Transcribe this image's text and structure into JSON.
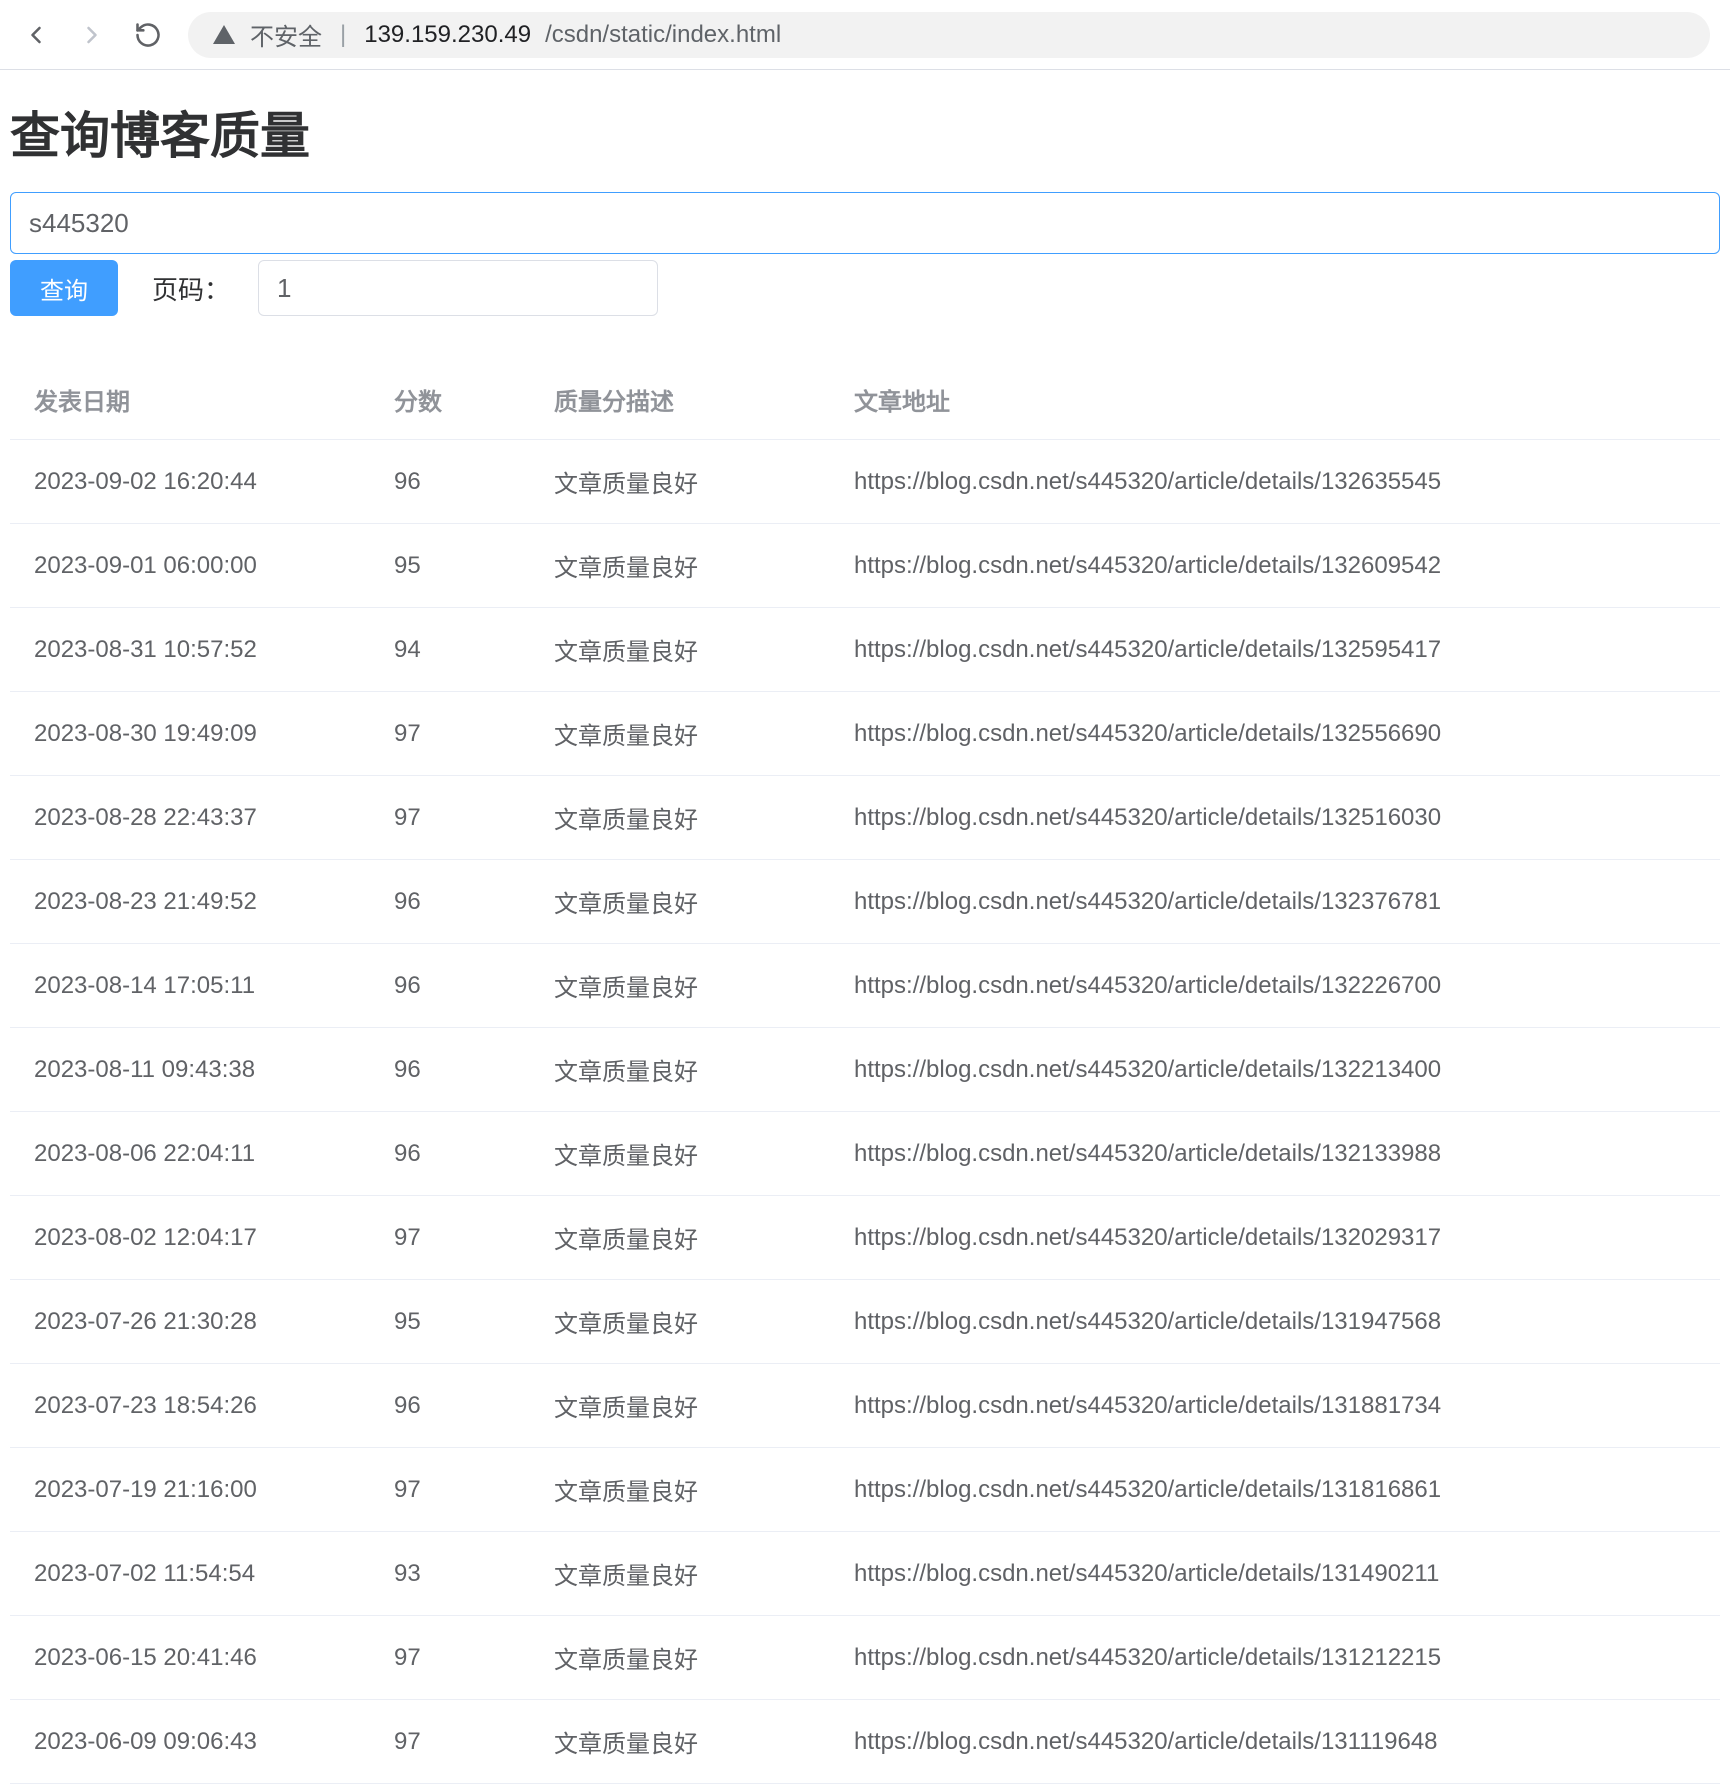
{
  "browser": {
    "insecure_label": "不安全",
    "url_host": "139.159.230.49",
    "url_path": "/csdn/static/index.html"
  },
  "page": {
    "title": "查询博客质量",
    "username_value": "s445320",
    "query_button_label": "查询",
    "page_label": "页码：",
    "page_value": "1"
  },
  "table": {
    "headers": {
      "date": "发表日期",
      "score": "分数",
      "desc": "质量分描述",
      "url": "文章地址"
    },
    "rows": [
      {
        "date": "2023-09-02 16:20:44",
        "score": "96",
        "desc": "文章质量良好",
        "url": "https://blog.csdn.net/s445320/article/details/132635545"
      },
      {
        "date": "2023-09-01 06:00:00",
        "score": "95",
        "desc": "文章质量良好",
        "url": "https://blog.csdn.net/s445320/article/details/132609542"
      },
      {
        "date": "2023-08-31 10:57:52",
        "score": "94",
        "desc": "文章质量良好",
        "url": "https://blog.csdn.net/s445320/article/details/132595417"
      },
      {
        "date": "2023-08-30 19:49:09",
        "score": "97",
        "desc": "文章质量良好",
        "url": "https://blog.csdn.net/s445320/article/details/132556690"
      },
      {
        "date": "2023-08-28 22:43:37",
        "score": "97",
        "desc": "文章质量良好",
        "url": "https://blog.csdn.net/s445320/article/details/132516030"
      },
      {
        "date": "2023-08-23 21:49:52",
        "score": "96",
        "desc": "文章质量良好",
        "url": "https://blog.csdn.net/s445320/article/details/132376781"
      },
      {
        "date": "2023-08-14 17:05:11",
        "score": "96",
        "desc": "文章质量良好",
        "url": "https://blog.csdn.net/s445320/article/details/132226700"
      },
      {
        "date": "2023-08-11 09:43:38",
        "score": "96",
        "desc": "文章质量良好",
        "url": "https://blog.csdn.net/s445320/article/details/132213400"
      },
      {
        "date": "2023-08-06 22:04:11",
        "score": "96",
        "desc": "文章质量良好",
        "url": "https://blog.csdn.net/s445320/article/details/132133988"
      },
      {
        "date": "2023-08-02 12:04:17",
        "score": "97",
        "desc": "文章质量良好",
        "url": "https://blog.csdn.net/s445320/article/details/132029317"
      },
      {
        "date": "2023-07-26 21:30:28",
        "score": "95",
        "desc": "文章质量良好",
        "url": "https://blog.csdn.net/s445320/article/details/131947568"
      },
      {
        "date": "2023-07-23 18:54:26",
        "score": "96",
        "desc": "文章质量良好",
        "url": "https://blog.csdn.net/s445320/article/details/131881734"
      },
      {
        "date": "2023-07-19 21:16:00",
        "score": "97",
        "desc": "文章质量良好",
        "url": "https://blog.csdn.net/s445320/article/details/131816861"
      },
      {
        "date": "2023-07-02 11:54:54",
        "score": "93",
        "desc": "文章质量良好",
        "url": "https://blog.csdn.net/s445320/article/details/131490211"
      },
      {
        "date": "2023-06-15 20:41:46",
        "score": "97",
        "desc": "文章质量良好",
        "url": "https://blog.csdn.net/s445320/article/details/131212215"
      },
      {
        "date": "2023-06-09 09:06:43",
        "score": "97",
        "desc": "文章质量良好",
        "url": "https://blog.csdn.net/s445320/article/details/131119648"
      }
    ]
  }
}
